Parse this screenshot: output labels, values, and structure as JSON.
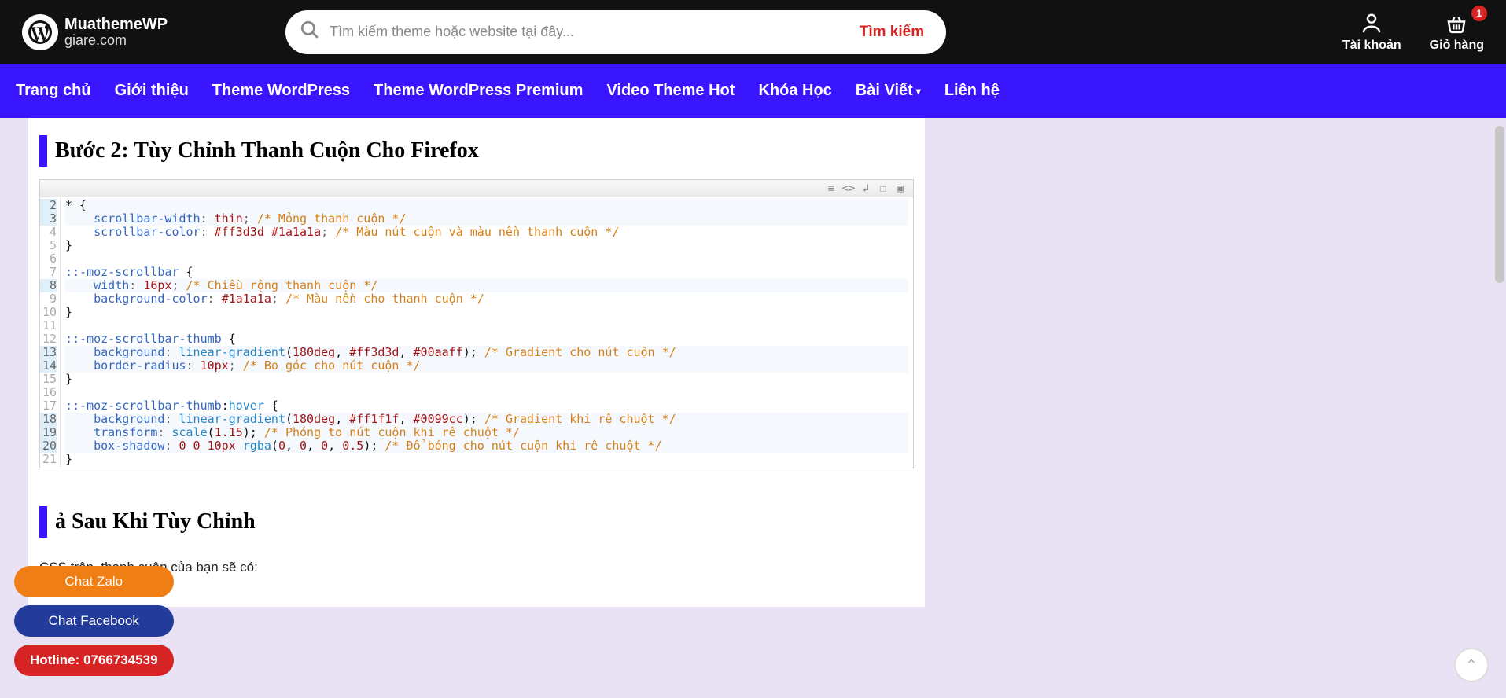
{
  "logo": {
    "line1": "MuathemeWP",
    "line2": "giare.com"
  },
  "search": {
    "placeholder": "Tìm kiếm theme hoặc website tại đây...",
    "button": "Tìm kiếm"
  },
  "account": {
    "label": "Tài khoản"
  },
  "cart": {
    "label": "Giỏ hàng",
    "badge": "1"
  },
  "nav": [
    "Trang chủ",
    "Giới thiệu",
    "Theme WordPress",
    "Theme WordPress Premium",
    "Video Theme Hot",
    "Khóa Học",
    "Bài Viết",
    "Liên hệ"
  ],
  "nav_dropdown_index": 7,
  "step_title": "Bước 2: Tùy Chỉnh Thanh Cuộn Cho Firefox",
  "code": {
    "gutter": [
      "2",
      "3",
      "4",
      "5",
      "6",
      "7",
      "8",
      "9",
      "10",
      "11",
      "12",
      "13",
      "14",
      "15",
      "16",
      "17",
      "18",
      "19",
      "20",
      "21"
    ],
    "hl_gutter": [
      2,
      3,
      8,
      13,
      14,
      18,
      19,
      20
    ],
    "lines": [
      [
        [
          "c-black",
          "* {"
        ]
      ],
      [
        [
          "",
          "    "
        ],
        [
          "c-prop",
          "scrollbar-width"
        ],
        [
          "c-punc",
          ": "
        ],
        [
          "c-val",
          "thin"
        ],
        [
          "c-punc",
          "; "
        ],
        [
          "c-comment",
          "/* Mỏng thanh cuộn */"
        ]
      ],
      [
        [
          "",
          "    "
        ],
        [
          "c-prop",
          "scrollbar-color"
        ],
        [
          "c-punc",
          ": "
        ],
        [
          "c-val",
          "#ff3d3d #1a1a1a"
        ],
        [
          "c-punc",
          "; "
        ],
        [
          "c-comment",
          "/* Màu nút cuộn và màu nền thanh cuộn */"
        ]
      ],
      [
        [
          "c-black",
          "}"
        ]
      ],
      [
        [
          "",
          ""
        ]
      ],
      [
        [
          "c-sel",
          "::-moz-scrollbar"
        ],
        [
          "c-black",
          " {"
        ]
      ],
      [
        [
          "",
          "    "
        ],
        [
          "c-prop",
          "width"
        ],
        [
          "c-punc",
          ": "
        ],
        [
          "c-num",
          "16px"
        ],
        [
          "c-punc",
          "; "
        ],
        [
          "c-comment",
          "/* Chiều rộng thanh cuộn */"
        ]
      ],
      [
        [
          "",
          "    "
        ],
        [
          "c-prop",
          "background-color"
        ],
        [
          "c-punc",
          ": "
        ],
        [
          "c-val",
          "#1a1a1a"
        ],
        [
          "c-punc",
          "; "
        ],
        [
          "c-comment",
          "/* Màu nền cho thanh cuộn */"
        ]
      ],
      [
        [
          "c-black",
          "}"
        ]
      ],
      [
        [
          "",
          ""
        ]
      ],
      [
        [
          "c-sel",
          "::-moz-scrollbar-thumb"
        ],
        [
          "c-black",
          " {"
        ]
      ],
      [
        [
          "",
          "    "
        ],
        [
          "c-prop",
          "background"
        ],
        [
          "c-punc",
          ": "
        ],
        [
          "c-alt",
          "linear-gradient"
        ],
        [
          "c-black",
          "("
        ],
        [
          "c-num",
          "180deg"
        ],
        [
          "c-black",
          ", "
        ],
        [
          "c-val",
          "#ff3d3d"
        ],
        [
          "c-black",
          ", "
        ],
        [
          "c-val",
          "#00aaff"
        ],
        [
          "c-black",
          "); "
        ],
        [
          "c-comment",
          "/* Gradient cho nút cuộn */"
        ]
      ],
      [
        [
          "",
          "    "
        ],
        [
          "c-prop",
          "border-radius"
        ],
        [
          "c-punc",
          ": "
        ],
        [
          "c-num",
          "10px"
        ],
        [
          "c-punc",
          "; "
        ],
        [
          "c-comment",
          "/* Bo góc cho nút cuộn */"
        ]
      ],
      [
        [
          "c-black",
          "}"
        ]
      ],
      [
        [
          "",
          ""
        ]
      ],
      [
        [
          "c-sel",
          "::-moz-scrollbar-thumb"
        ],
        [
          "c-black",
          ":"
        ],
        [
          "c-alt",
          "hover"
        ],
        [
          "c-black",
          " {"
        ]
      ],
      [
        [
          "",
          "    "
        ],
        [
          "c-prop",
          "background"
        ],
        [
          "c-punc",
          ": "
        ],
        [
          "c-alt",
          "linear-gradient"
        ],
        [
          "c-black",
          "("
        ],
        [
          "c-num",
          "180deg"
        ],
        [
          "c-black",
          ", "
        ],
        [
          "c-val",
          "#ff1f1f"
        ],
        [
          "c-black",
          ", "
        ],
        [
          "c-val",
          "#0099cc"
        ],
        [
          "c-black",
          "); "
        ],
        [
          "c-comment",
          "/* Gradient khi rê chuột */"
        ]
      ],
      [
        [
          "",
          "    "
        ],
        [
          "c-prop",
          "transform"
        ],
        [
          "c-punc",
          ": "
        ],
        [
          "c-alt",
          "scale"
        ],
        [
          "c-black",
          "("
        ],
        [
          "c-num",
          "1.15"
        ],
        [
          "c-black",
          "); "
        ],
        [
          "c-comment",
          "/* Phóng to nút cuộn khi rê chuột */"
        ]
      ],
      [
        [
          "",
          "    "
        ],
        [
          "c-prop",
          "box-shadow"
        ],
        [
          "c-punc",
          ": "
        ],
        [
          "c-num",
          "0 0 10px "
        ],
        [
          "c-alt",
          "rgba"
        ],
        [
          "c-black",
          "("
        ],
        [
          "c-num",
          "0"
        ],
        [
          "c-black",
          ", "
        ],
        [
          "c-num",
          "0"
        ],
        [
          "c-black",
          ", "
        ],
        [
          "c-num",
          "0"
        ],
        [
          "c-black",
          ", "
        ],
        [
          "c-num",
          "0.5"
        ],
        [
          "c-black",
          "); "
        ],
        [
          "c-comment",
          "/* Đổ bóng cho nút cuộn khi rê chuột */"
        ]
      ],
      [
        [
          "c-black",
          "}"
        ]
      ]
    ]
  },
  "result_title_full": "Kết Quả Sau Khi Tùy Chỉnh",
  "result_title_visible": "ả Sau Khi Tùy Chỉnh",
  "result_desc": "CSS trên, thanh cuộn của bạn sẽ có:",
  "float": {
    "zalo": "Chat Zalo",
    "fb": "Chat Facebook",
    "hotline": "Hotline: 0766734539"
  }
}
